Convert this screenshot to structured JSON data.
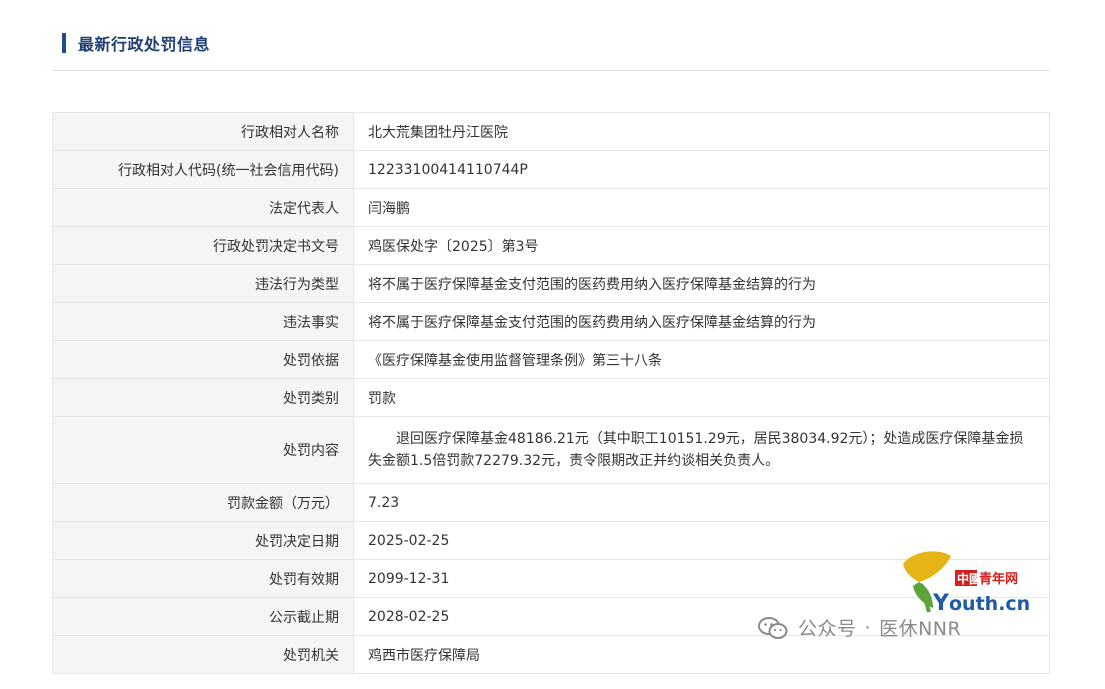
{
  "section": {
    "title": "最新行政处罚信息"
  },
  "rows": [
    {
      "label": "行政相对人名称",
      "value": "北大荒集团牡丹江医院"
    },
    {
      "label": "行政相对人代码(统一社会信用代码)",
      "value": "12233100414110744P"
    },
    {
      "label": "法定代表人",
      "value": "闫海鹏"
    },
    {
      "label": "行政处罚决定书文号",
      "value": "鸡医保处字〔2025〕第3号"
    },
    {
      "label": "违法行为类型",
      "value": "将不属于医疗保障基金支付范围的医药费用纳入医疗保障基金结算的行为"
    },
    {
      "label": "违法事实",
      "value": "将不属于医疗保障基金支付范围的医药费用纳入医疗保障基金结算的行为"
    },
    {
      "label": "处罚依据",
      "value": "《医疗保障基金使用监督管理条例》第三十八条"
    },
    {
      "label": "处罚类别",
      "value": "罚款"
    },
    {
      "label": "处罚内容",
      "value": "退回医疗保障基金48186.21元（其中职工10151.29元，居民38034.92元）；处造成医疗保障基金损失金额1.5倍罚款72279.32元，责令限期改正并约谈相关负责人。"
    },
    {
      "label": "罚款金额（万元）",
      "value": "7.23"
    },
    {
      "label": "处罚决定日期",
      "value": "2025-02-25"
    },
    {
      "label": "处罚有效期",
      "value": "2099-12-31"
    },
    {
      "label": "公示截止期",
      "value": "2028-02-25"
    },
    {
      "label": "处罚机关",
      "value": "鸡西市医疗保障局"
    }
  ],
  "watermark": {
    "logo_text_cn": "中國青年网",
    "logo_text_domain": "outh.cn",
    "logo_letter": "Y",
    "account_prefix": "公众号",
    "account_sep": "·",
    "account_name": "医休NNR",
    "logo_colors": {
      "gold": "#e7b416",
      "green": "#5aa43a",
      "red": "#d32020",
      "blue": "#1e5aa8"
    }
  }
}
